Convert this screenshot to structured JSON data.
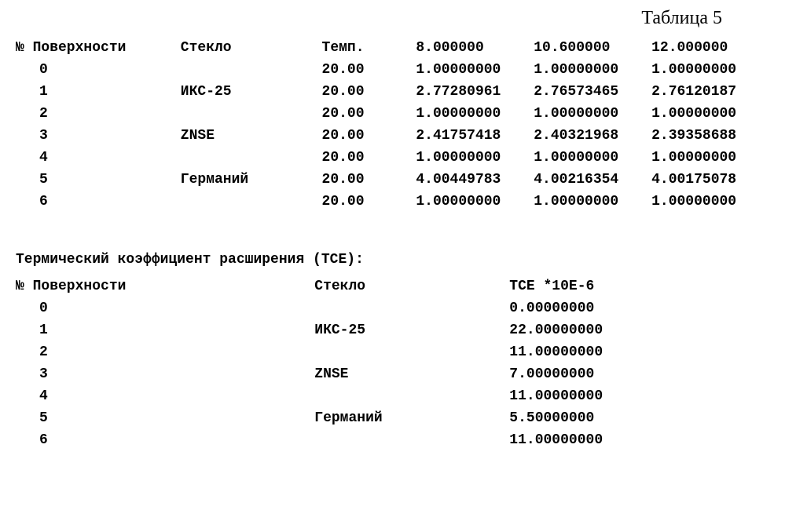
{
  "title": "Таблица 5",
  "table1": {
    "headers": {
      "surface": "№ Поверхности",
      "glass": "Стекло",
      "temp": "Темп.",
      "c1": "8.000000",
      "c2": "10.600000",
      "c3": "12.000000"
    },
    "rows": [
      {
        "num": "0",
        "glass": "",
        "temp": "20.00",
        "a": "1.00000000",
        "b": "1.00000000",
        "c": "1.00000000"
      },
      {
        "num": "1",
        "glass": "ИКС-25",
        "temp": "20.00",
        "a": "2.77280961",
        "b": "2.76573465",
        "c": "2.76120187"
      },
      {
        "num": "2",
        "glass": "",
        "temp": "20.00",
        "a": "1.00000000",
        "b": "1.00000000",
        "c": "1.00000000"
      },
      {
        "num": "3",
        "glass": "ZNSE",
        "temp": "20.00",
        "a": "2.41757418",
        "b": "2.40321968",
        "c": "2.39358688"
      },
      {
        "num": "4",
        "glass": "",
        "temp": "20.00",
        "a": "1.00000000",
        "b": "1.00000000",
        "c": "1.00000000"
      },
      {
        "num": "5",
        "glass": "Германий",
        "temp": "20.00",
        "a": "4.00449783",
        "b": "4.00216354",
        "c": "4.00175078"
      },
      {
        "num": "6",
        "glass": "",
        "temp": "20.00",
        "a": "1.00000000",
        "b": "1.00000000",
        "c": "1.00000000"
      }
    ]
  },
  "tce": {
    "title": "Термический коэффициент расширения (TCE):",
    "headers": {
      "surface": "№ Поверхности",
      "glass": "Стекло",
      "val": "TCE *10E-6"
    },
    "rows": [
      {
        "num": "0",
        "glass": "",
        "val": "0.00000000"
      },
      {
        "num": "1",
        "glass": "ИКС-25",
        "val": "22.00000000"
      },
      {
        "num": "2",
        "glass": "",
        "val": "11.00000000"
      },
      {
        "num": "3",
        "glass": "ZNSE",
        "val": "7.00000000"
      },
      {
        "num": "4",
        "glass": "",
        "val": "11.00000000"
      },
      {
        "num": "5",
        "glass": "Германий",
        "val": "5.50000000"
      },
      {
        "num": "6",
        "glass": "",
        "val": "11.00000000"
      }
    ]
  },
  "chart_data": [
    {
      "type": "table",
      "title": "Таблица 5 — refractive indices",
      "columns": [
        "№ Поверхности",
        "Стекло",
        "Темп.",
        "8.000000",
        "10.600000",
        "12.000000"
      ],
      "rows": [
        [
          0,
          "",
          20.0,
          1.0,
          1.0,
          1.0
        ],
        [
          1,
          "ИКС-25",
          20.0,
          2.77280961,
          2.76573465,
          2.76120187
        ],
        [
          2,
          "",
          20.0,
          1.0,
          1.0,
          1.0
        ],
        [
          3,
          "ZNSE",
          20.0,
          2.41757418,
          2.40321968,
          2.39358688
        ],
        [
          4,
          "",
          20.0,
          1.0,
          1.0,
          1.0
        ],
        [
          5,
          "Германий",
          20.0,
          4.00449783,
          4.00216354,
          4.00175078
        ],
        [
          6,
          "",
          20.0,
          1.0,
          1.0,
          1.0
        ]
      ]
    },
    {
      "type": "table",
      "title": "Термический коэффициент расширения (TCE)",
      "columns": [
        "№ Поверхности",
        "Стекло",
        "TCE *10E-6"
      ],
      "rows": [
        [
          0,
          "",
          0.0
        ],
        [
          1,
          "ИКС-25",
          22.0
        ],
        [
          2,
          "",
          11.0
        ],
        [
          3,
          "ZNSE",
          7.0
        ],
        [
          4,
          "",
          11.0
        ],
        [
          5,
          "Германий",
          5.5
        ],
        [
          6,
          "",
          11.0
        ]
      ]
    }
  ]
}
